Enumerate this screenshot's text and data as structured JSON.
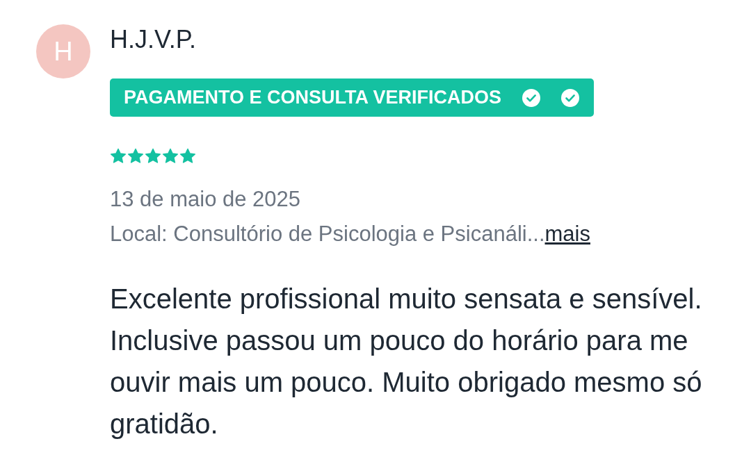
{
  "review": {
    "avatar": {
      "initial": "H"
    },
    "author": "H.J.V.P.",
    "badge": {
      "label": "PAGAMENTO E CONSULTA VERIFICADOS",
      "icons": [
        {
          "kind": "check"
        },
        {
          "kind": "check"
        }
      ]
    },
    "rating": {
      "stars": 5
    },
    "date": "13 de maio de 2025",
    "location": {
      "text": "Local: Consultório de Psicologia e Psicanáli...",
      "more_link": "mais"
    },
    "text": "Excelente profissional muito sensata e sensível. Inclusive passou um pouco do horário para me ouvir mais um pouco. Muito obrigado mesmo só gratidão."
  }
}
